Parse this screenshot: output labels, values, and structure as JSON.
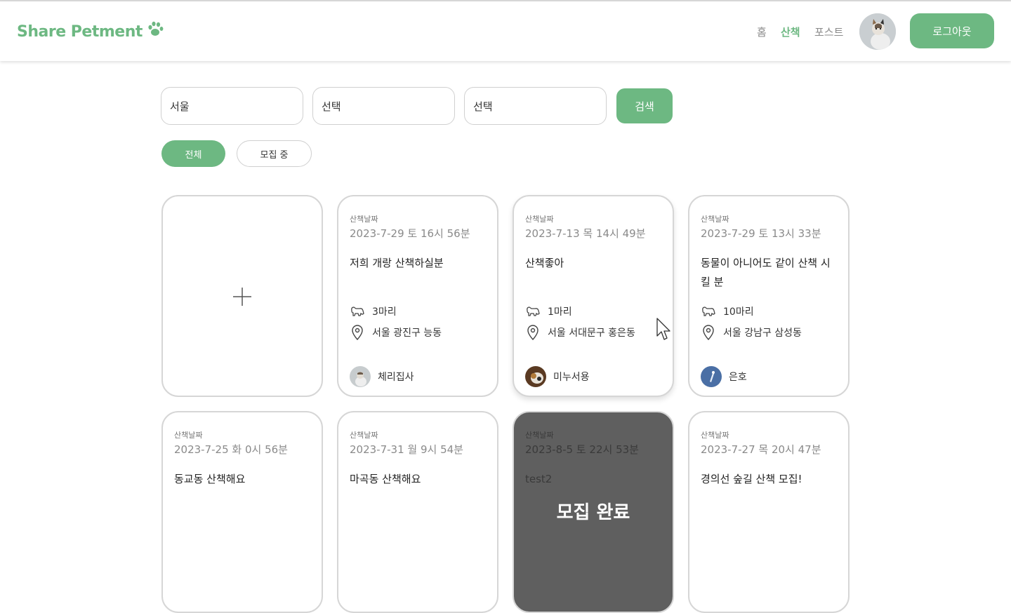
{
  "header": {
    "logo": "Share Petment",
    "nav": [
      {
        "label": "홈",
        "active": false
      },
      {
        "label": "산책",
        "active": true
      },
      {
        "label": "포스트",
        "active": false
      }
    ],
    "logout_label": "로그아웃"
  },
  "search": {
    "region": "서울",
    "district": "선택",
    "neighborhood": "선택",
    "button_label": "검색"
  },
  "filters": {
    "all_label": "전체",
    "recruiting_label": "모집 중",
    "selected": "전체"
  },
  "colors": {
    "accent": "#6db882",
    "completed_overlay": "#5f5f5f"
  },
  "cards": [
    {
      "date_label": "산책날짜",
      "date": "2023-7-29 토 16시 56분",
      "title": "저희 개랑 산책하실분",
      "pets": "3마리",
      "location": "서울 광진구 능동",
      "owner": "체리집사"
    },
    {
      "date_label": "산책날짜",
      "date": "2023-7-13 목 14시 49분",
      "title": "산책좋아",
      "pets": "1마리",
      "location": "서울 서대문구 홍은동",
      "owner": "미누서용"
    },
    {
      "date_label": "산책날짜",
      "date": "2023-7-29 토 13시 33분",
      "title": "동물이 아니어도 같이 산책 시킬 분",
      "pets": "10마리",
      "location": "서울 강남구 삼성동",
      "owner": "은호"
    },
    {
      "date_label": "산책날짜",
      "date": "2023-7-25 화 0시 56분",
      "title": "동교동 산책해요"
    },
    {
      "date_label": "산책날짜",
      "date": "2023-7-31 월 9시 54분",
      "title": "마곡동 산책해요"
    },
    {
      "date_label": "산책날짜",
      "date": "2023-8-5 토 22시 53분",
      "title": "test2",
      "status": "모집 완료"
    },
    {
      "date_label": "산책날짜",
      "date": "2023-7-27 목 20시 47분",
      "title": "경의선 숲길 산책 모집!"
    }
  ]
}
